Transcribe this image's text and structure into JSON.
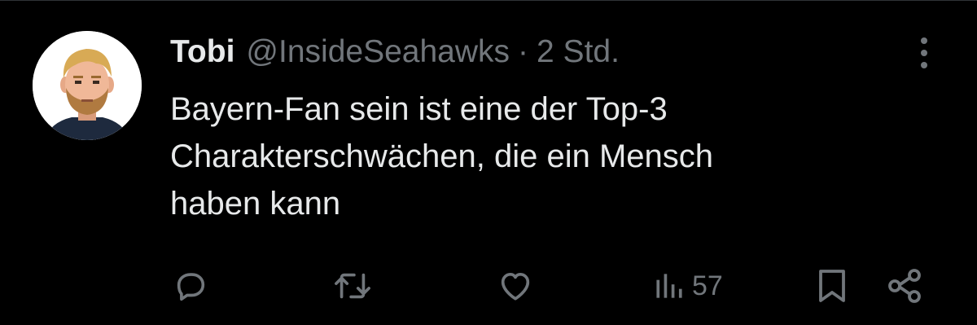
{
  "tweet": {
    "author": {
      "display_name": "Tobi",
      "handle": "@InsideSeahawks",
      "separator": "·",
      "timestamp": "2 Std.",
      "avatar_icon": "avatar-cartoon-man"
    },
    "text": "Bayern-Fan sein ist eine der Top-3\nCharakterschwächen, die ein Mensch\nhaben kann",
    "more_icon": "more-vertical-icon",
    "actions": {
      "reply_icon": "reply-icon",
      "retweet_icon": "retweet-icon",
      "like_icon": "heart-icon",
      "views_icon": "views-bar-chart-icon",
      "views_count": "57",
      "bookmark_icon": "bookmark-icon",
      "share_icon": "share-icon"
    }
  },
  "colors": {
    "background": "#000000",
    "primary_text": "#e7e9ea",
    "secondary_text": "#71767b",
    "icon": "#71767b"
  }
}
